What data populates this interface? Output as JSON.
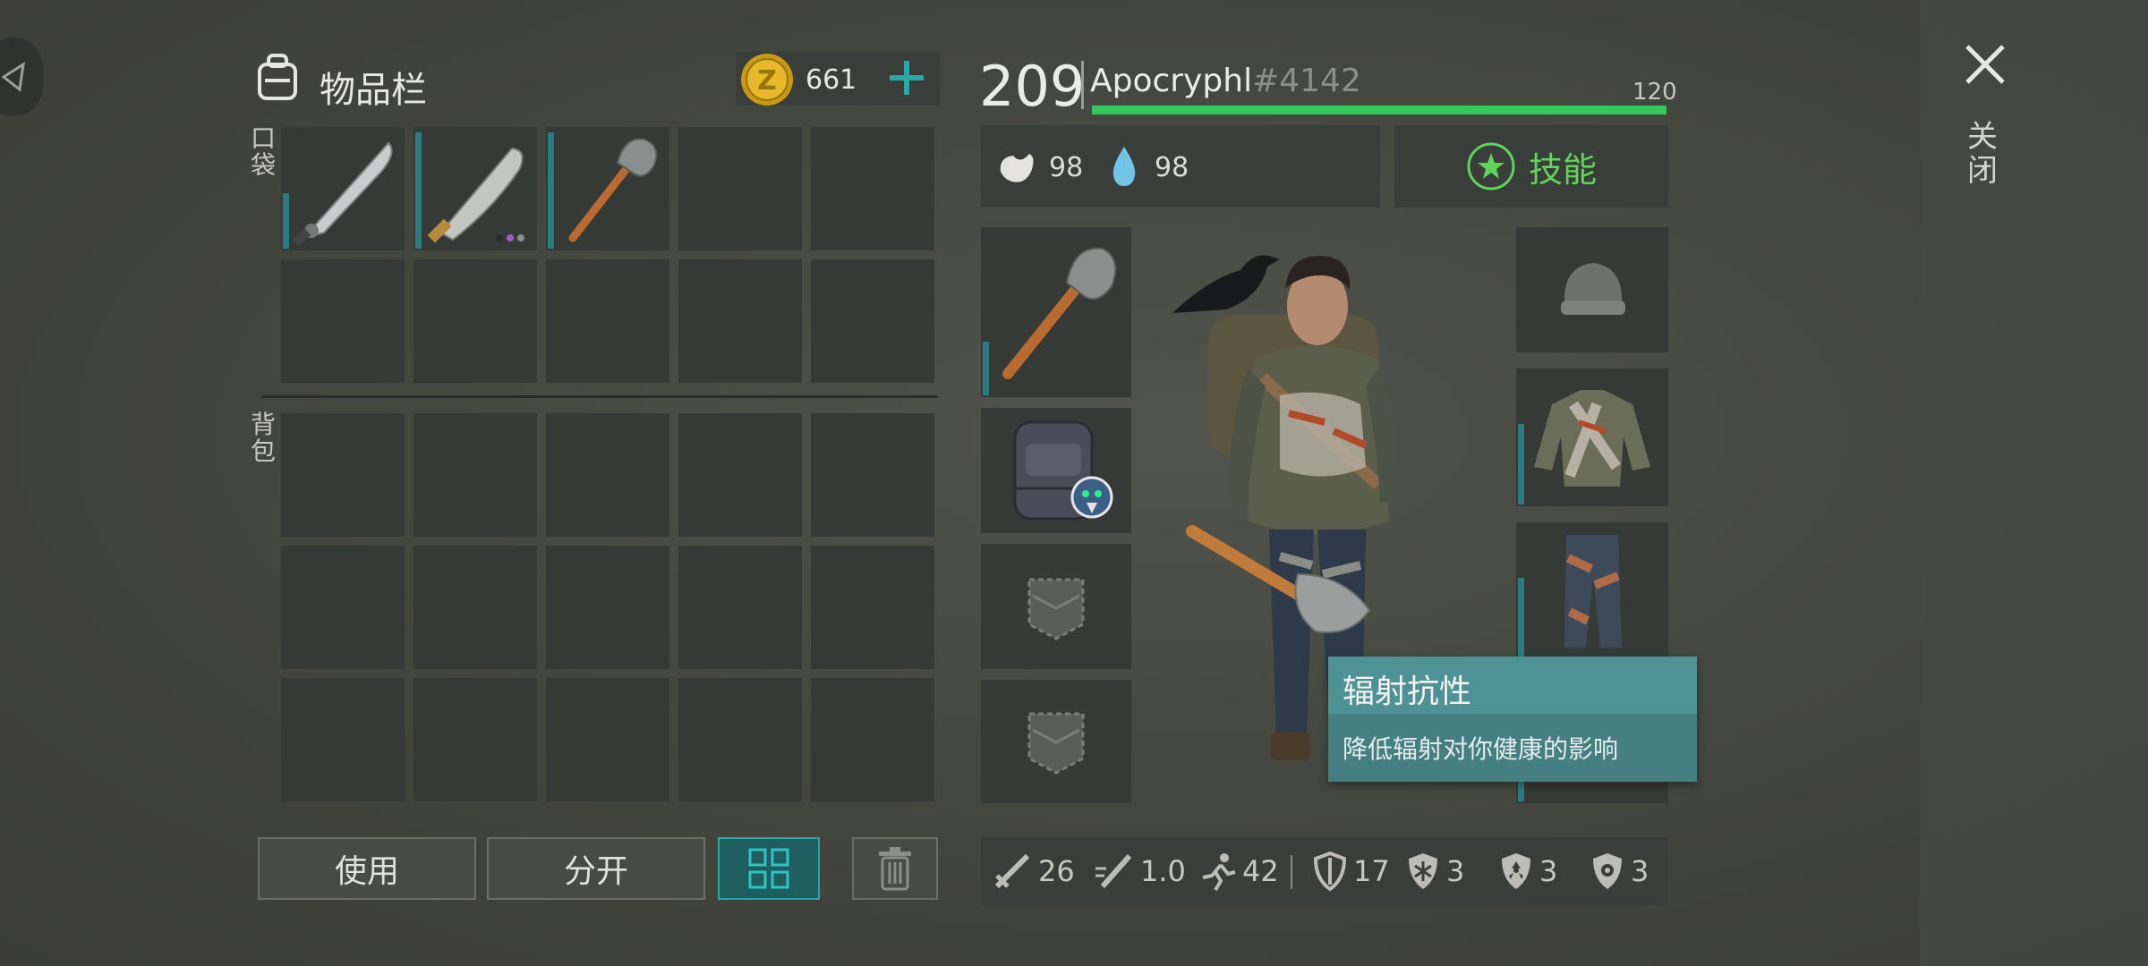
{
  "inventory": {
    "title": "物品栏",
    "icon": "backpack-icon",
    "coins": "661",
    "pockets_label": "口袋",
    "backpack_label": "背包"
  },
  "player": {
    "level": "209",
    "name": "Apocryphl",
    "tag": "#4142",
    "xp_max_label": "120",
    "xp_fraction": 1.0,
    "hunger": "98",
    "thirst": "98",
    "skills_label": "技能"
  },
  "tooltip": {
    "title": "辐射抗性",
    "description": "降低辐射对你健康的影响"
  },
  "buttons": {
    "use": "使用",
    "split": "分开"
  },
  "stats": {
    "damage": "26",
    "attack_speed": "1.0",
    "speed": "42",
    "armor": "17",
    "cold": "3",
    "radiation": "3",
    "infection": "3"
  },
  "close": {
    "label": "关闭"
  },
  "colors": {
    "accent": "#2a7c80",
    "xp_green": "#34c759",
    "tooltip_bg": "#4b8b8f",
    "skills_green": "#5fd35a"
  }
}
